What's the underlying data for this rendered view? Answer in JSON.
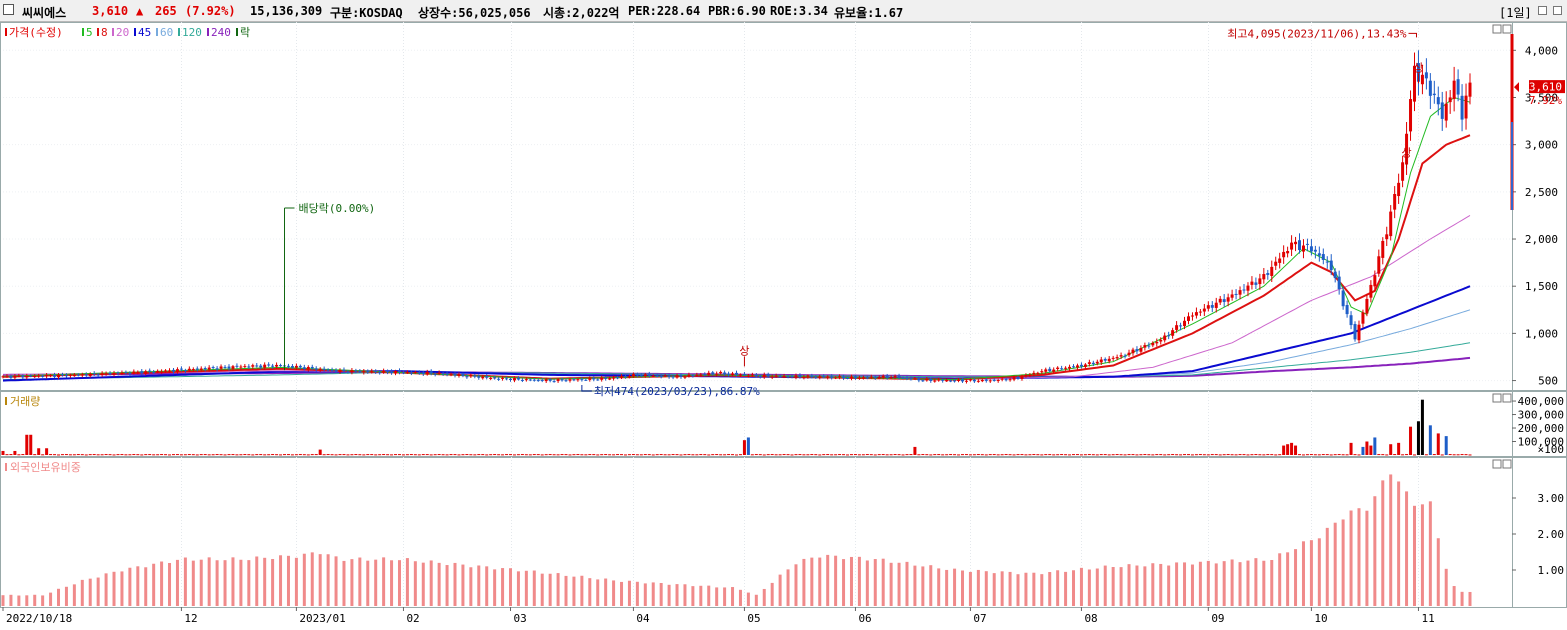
{
  "header": {
    "name": "씨씨에스",
    "price": "3,610",
    "change_arrow": "▲",
    "change": "265",
    "change_pct": "(7.92%)",
    "volume": "15,136,309",
    "market": "구분:KOSDAQ",
    "shares": "상장수:56,025,056",
    "mcap": "시총:2,022억",
    "per": "PER:228.64",
    "pbr": "PBR:6.90",
    "roe": "ROE:3.34",
    "float": "유보율:1.67",
    "period": "[1일]"
  },
  "colors": {
    "up": "#e00000",
    "down": "#1e5ec8",
    "ma5": "#22bb22",
    "ma8": "#dd1111",
    "ma20": "#cc66cc",
    "ma45": "#0a0ad0",
    "ma60": "#77aadd",
    "ma120": "#33aa99",
    "ma240": "#8822bb",
    "foreign": "#f08a8a"
  },
  "chart_data": [
    {
      "type": "line",
      "panel": "price",
      "legend": [
        "가격(수정)",
        "5",
        "8",
        "20",
        "45",
        "60",
        "120",
        "240",
        "락"
      ],
      "yticks": [
        "4,000",
        "3,500",
        "3,000",
        "2,500",
        "2,000",
        "1,500",
        "1,000",
        "500"
      ],
      "ylim": [
        400,
        4300
      ],
      "annotations": {
        "high": "최고4,095(2023/11/06),13.43%",
        "low": "최저474(2023/03/23),86.87%",
        "dividend": "배당락(0.00%)",
        "upper_limit": "상",
        "last_price": "3,610",
        "last_pct": "7.92%"
      },
      "series": [
        {
          "name": "가격(수정)",
          "points": [
            [
              0,
              540
            ],
            [
              20,
              560
            ],
            [
              40,
              600
            ],
            [
              60,
              650
            ],
            [
              70,
              660
            ],
            [
              85,
              600
            ],
            [
              100,
              590
            ],
            [
              110,
              575
            ],
            [
              125,
              520
            ],
            [
              138,
              500
            ],
            [
              152,
              520
            ],
            [
              160,
              560
            ],
            [
              170,
              540
            ],
            [
              180,
              580
            ],
            [
              190,
              550
            ],
            [
              205,
              540
            ],
            [
              215,
              530
            ],
            [
              225,
              540
            ],
            [
              232,
              505
            ],
            [
              240,
              500
            ],
            [
              249,
              500
            ],
            [
              255,
              520
            ],
            [
              262,
              600
            ],
            [
              272,
              660
            ],
            [
              282,
              760
            ],
            [
              292,
              930
            ],
            [
              300,
              1200
            ],
            [
              310,
              1400
            ],
            [
              318,
              1600
            ],
            [
              325,
              1950
            ],
            [
              330,
              1900
            ],
            [
              335,
              1700
            ],
            [
              338,
              1320
            ],
            [
              341,
              950
            ],
            [
              345,
              1500
            ],
            [
              349,
              2100
            ],
            [
              353,
              2800
            ],
            [
              356,
              3800
            ],
            [
              360,
              3600
            ],
            [
              363,
              3300
            ],
            [
              366,
              3650
            ],
            [
              368,
              3345
            ],
            [
              370,
              3610
            ]
          ]
        },
        {
          "name": "5",
          "points": [
            [
              0,
              545
            ],
            [
              70,
              640
            ],
            [
              100,
              585
            ],
            [
              138,
              515
            ],
            [
              180,
              560
            ],
            [
              240,
              510
            ],
            [
              262,
              575
            ],
            [
              280,
              700
            ],
            [
              300,
              1100
            ],
            [
              318,
              1500
            ],
            [
              328,
              1900
            ],
            [
              335,
              1750
            ],
            [
              340,
              1280
            ],
            [
              344,
              1200
            ],
            [
              350,
              1800
            ],
            [
              355,
              2700
            ],
            [
              360,
              3300
            ],
            [
              366,
              3500
            ],
            [
              370,
              3450
            ]
          ]
        },
        {
          "name": "8",
          "points": [
            [
              0,
              540
            ],
            [
              70,
              625
            ],
            [
              100,
              585
            ],
            [
              138,
              520
            ],
            [
              180,
              555
            ],
            [
              240,
              510
            ],
            [
              262,
              560
            ],
            [
              280,
              660
            ],
            [
              300,
              1000
            ],
            [
              318,
              1400
            ],
            [
              330,
              1750
            ],
            [
              335,
              1650
            ],
            [
              341,
              1350
            ],
            [
              346,
              1450
            ],
            [
              352,
              2000
            ],
            [
              358,
              2800
            ],
            [
              364,
              3000
            ],
            [
              370,
              3100
            ]
          ]
        },
        {
          "name": "20",
          "points": [
            [
              0,
              560
            ],
            [
              70,
              605
            ],
            [
              100,
              590
            ],
            [
              138,
              525
            ],
            [
              180,
              550
            ],
            [
              240,
              512
            ],
            [
              270,
              540
            ],
            [
              290,
              640
            ],
            [
              310,
              900
            ],
            [
              330,
              1350
            ],
            [
              345,
              1600
            ],
            [
              360,
              2000
            ],
            [
              370,
              2250
            ]
          ]
        },
        {
          "name": "45",
          "points": [
            [
              0,
              500
            ],
            [
              70,
              595
            ],
            [
              100,
              600
            ],
            [
              138,
              560
            ],
            [
              180,
              545
            ],
            [
              240,
              520
            ],
            [
              280,
              540
            ],
            [
              300,
              600
            ],
            [
              320,
              800
            ],
            [
              340,
              1000
            ],
            [
              355,
              1250
            ],
            [
              370,
              1500
            ]
          ]
        },
        {
          "name": "60",
          "points": [
            [
              0,
              500
            ],
            [
              70,
              590
            ],
            [
              100,
              600
            ],
            [
              138,
              570
            ],
            [
              180,
              550
            ],
            [
              240,
              525
            ],
            [
              280,
              540
            ],
            [
              300,
              580
            ],
            [
              320,
              700
            ],
            [
              340,
              880
            ],
            [
              355,
              1050
            ],
            [
              370,
              1250
            ]
          ]
        },
        {
          "name": "120",
          "points": [
            [
              0,
              510
            ],
            [
              70,
              560
            ],
            [
              100,
              590
            ],
            [
              138,
              580
            ],
            [
              180,
              560
            ],
            [
              240,
              540
            ],
            [
              280,
              540
            ],
            [
              300,
              560
            ],
            [
              320,
              640
            ],
            [
              340,
              720
            ],
            [
              355,
              800
            ],
            [
              370,
              900
            ]
          ]
        },
        {
          "name": "240",
          "points": [
            [
              0,
              560
            ],
            [
              70,
              580
            ],
            [
              100,
              590
            ],
            [
              138,
              580
            ],
            [
              180,
              565
            ],
            [
              240,
              545
            ],
            [
              280,
              540
            ],
            [
              300,
              550
            ],
            [
              320,
              600
            ],
            [
              340,
              640
            ],
            [
              355,
              680
            ],
            [
              370,
              740
            ]
          ]
        }
      ]
    },
    {
      "type": "bar",
      "panel": "volume",
      "legend": [
        "거래량"
      ],
      "yticks": [
        "400,000",
        "300,000",
        "200,000",
        "100,000"
      ],
      "unit": "×100",
      "ylim": [
        0,
        430000
      ],
      "spikes": [
        [
          0,
          30000
        ],
        [
          3,
          30000
        ],
        [
          6,
          150000
        ],
        [
          7,
          150000
        ],
        [
          9,
          50000
        ],
        [
          11,
          50000
        ],
        [
          80,
          40000
        ],
        [
          187,
          110000
        ],
        [
          188,
          130000
        ],
        [
          230,
          60000
        ],
        [
          323,
          70000
        ],
        [
          324,
          80000
        ],
        [
          325,
          90000
        ],
        [
          326,
          70000
        ],
        [
          340,
          90000
        ],
        [
          343,
          60000
        ],
        [
          344,
          100000
        ],
        [
          345,
          70000
        ],
        [
          346,
          130000
        ],
        [
          350,
          80000
        ],
        [
          352,
          90000
        ],
        [
          355,
          210000
        ],
        [
          357,
          250000
        ],
        [
          358,
          410000
        ],
        [
          360,
          220000
        ],
        [
          362,
          160000
        ],
        [
          364,
          140000
        ]
      ]
    },
    {
      "type": "bar",
      "panel": "foreign",
      "legend": [
        "외국인보유비중"
      ],
      "yticks": [
        "3.00",
        "2.00",
        "1.00"
      ],
      "ylim": [
        0,
        4.0
      ],
      "series": [
        {
          "name": "외국인보유비중",
          "points": [
            [
              0,
              0.3
            ],
            [
              10,
              0.3
            ],
            [
              20,
              0.7
            ],
            [
              30,
              1.0
            ],
            [
              45,
              1.3
            ],
            [
              60,
              1.3
            ],
            [
              75,
              1.4
            ],
            [
              80,
              1.5
            ],
            [
              85,
              1.3
            ],
            [
              100,
              1.3
            ],
            [
              110,
              1.2
            ],
            [
              130,
              1.0
            ],
            [
              155,
              0.7
            ],
            [
              185,
              0.5
            ],
            [
              190,
              0.3
            ],
            [
              200,
              1.2
            ],
            [
              206,
              1.4
            ],
            [
              220,
              1.3
            ],
            [
              240,
              1.0
            ],
            [
              260,
              0.9
            ],
            [
              270,
              1.0
            ],
            [
              280,
              1.1
            ],
            [
              300,
              1.2
            ],
            [
              320,
              1.3
            ],
            [
              333,
              2.0
            ],
            [
              338,
              2.5
            ],
            [
              345,
              2.8
            ],
            [
              350,
              3.8
            ],
            [
              355,
              2.9
            ],
            [
              360,
              2.8
            ],
            [
              363,
              1.5
            ],
            [
              365,
              0.6
            ],
            [
              368,
              0.4
            ]
          ]
        }
      ]
    }
  ],
  "x_axis": {
    "labels": [
      {
        "text": "2022/10/18",
        "i": 0
      },
      {
        "text": "12",
        "i": 45
      },
      {
        "text": "2023/01",
        "i": 74
      },
      {
        "text": "02",
        "i": 101
      },
      {
        "text": "03",
        "i": 128
      },
      {
        "text": "04",
        "i": 159
      },
      {
        "text": "05",
        "i": 187
      },
      {
        "text": "06",
        "i": 215
      },
      {
        "text": "07",
        "i": 244
      },
      {
        "text": "08",
        "i": 272
      },
      {
        "text": "09",
        "i": 304
      },
      {
        "text": "10",
        "i": 330
      },
      {
        "text": "11",
        "i": 357
      }
    ]
  }
}
